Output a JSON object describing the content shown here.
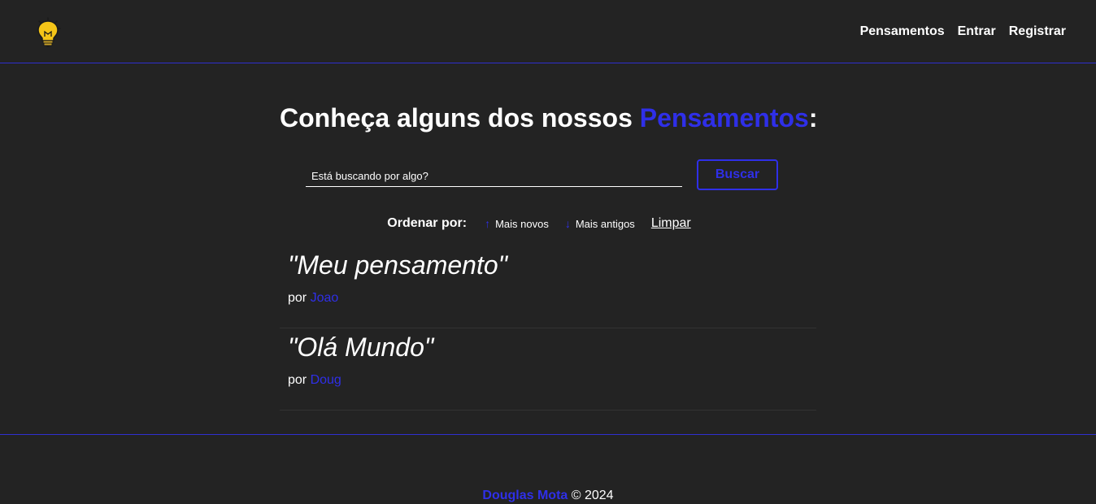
{
  "navbar": {
    "logo_icon": "lightbulb-icon",
    "links": [
      {
        "label": "Pensamentos"
      },
      {
        "label": "Entrar"
      },
      {
        "label": "Registrar"
      }
    ]
  },
  "main": {
    "title_prefix": "Conheça alguns dos nossos ",
    "title_highlight": "Pensamentos",
    "title_suffix": ":",
    "search": {
      "placeholder": "Está buscando por algo?",
      "button_label": "Buscar"
    },
    "order": {
      "label": "Ordenar por:",
      "newest_label": "Mais novos",
      "newest_icon": "arrow-up-icon",
      "oldest_label": "Mais antigos",
      "oldest_icon": "arrow-down-icon",
      "clear_label": "Limpar"
    },
    "thoughts": [
      {
        "text": "\"Meu pensamento\"",
        "by": "por ",
        "author": "Joao"
      },
      {
        "text": "\"Olá Mundo\"",
        "by": "por ",
        "author": "Doug"
      }
    ]
  },
  "footer": {
    "author": "Douglas Mota",
    "copyright": " © 2024"
  },
  "colors": {
    "background": "#232323",
    "accent": "#2f2fe8",
    "text": "#ffffff"
  }
}
